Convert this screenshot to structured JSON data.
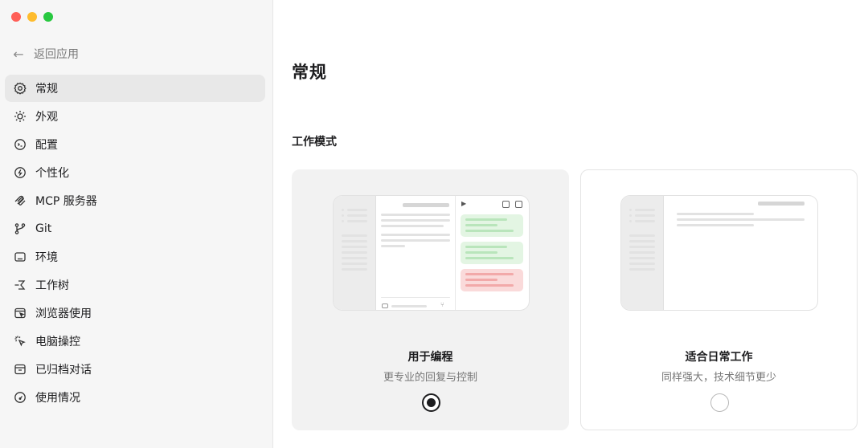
{
  "window": {
    "controls": [
      "close",
      "minimize",
      "zoom"
    ]
  },
  "sidebar": {
    "back_label": "返回应用",
    "items": [
      {
        "label": "常规",
        "icon": "gear-icon",
        "active": true
      },
      {
        "label": "外观",
        "icon": "sun-icon"
      },
      {
        "label": "配置",
        "icon": "config-face-icon"
      },
      {
        "label": "个性化",
        "icon": "personalize-icon"
      },
      {
        "label": "MCP 服务器",
        "icon": "mcp-icon"
      },
      {
        "label": "Git",
        "icon": "git-branch-icon"
      },
      {
        "label": "环境",
        "icon": "environment-icon"
      },
      {
        "label": "工作树",
        "icon": "worktree-icon"
      },
      {
        "label": "浏览器使用",
        "icon": "browser-icon"
      },
      {
        "label": "电脑操控",
        "icon": "cursor-click-icon"
      },
      {
        "label": "已归档对话",
        "icon": "archive-icon"
      },
      {
        "label": "使用情况",
        "icon": "gauge-icon"
      }
    ]
  },
  "main": {
    "title": "常规",
    "section_title": "工作模式",
    "modes": [
      {
        "title": "用于编程",
        "subtitle": "更专业的回复与控制",
        "selected": true
      },
      {
        "title": "适合日常工作",
        "subtitle": "同样强大，技术细节更少",
        "selected": false
      }
    ]
  }
}
